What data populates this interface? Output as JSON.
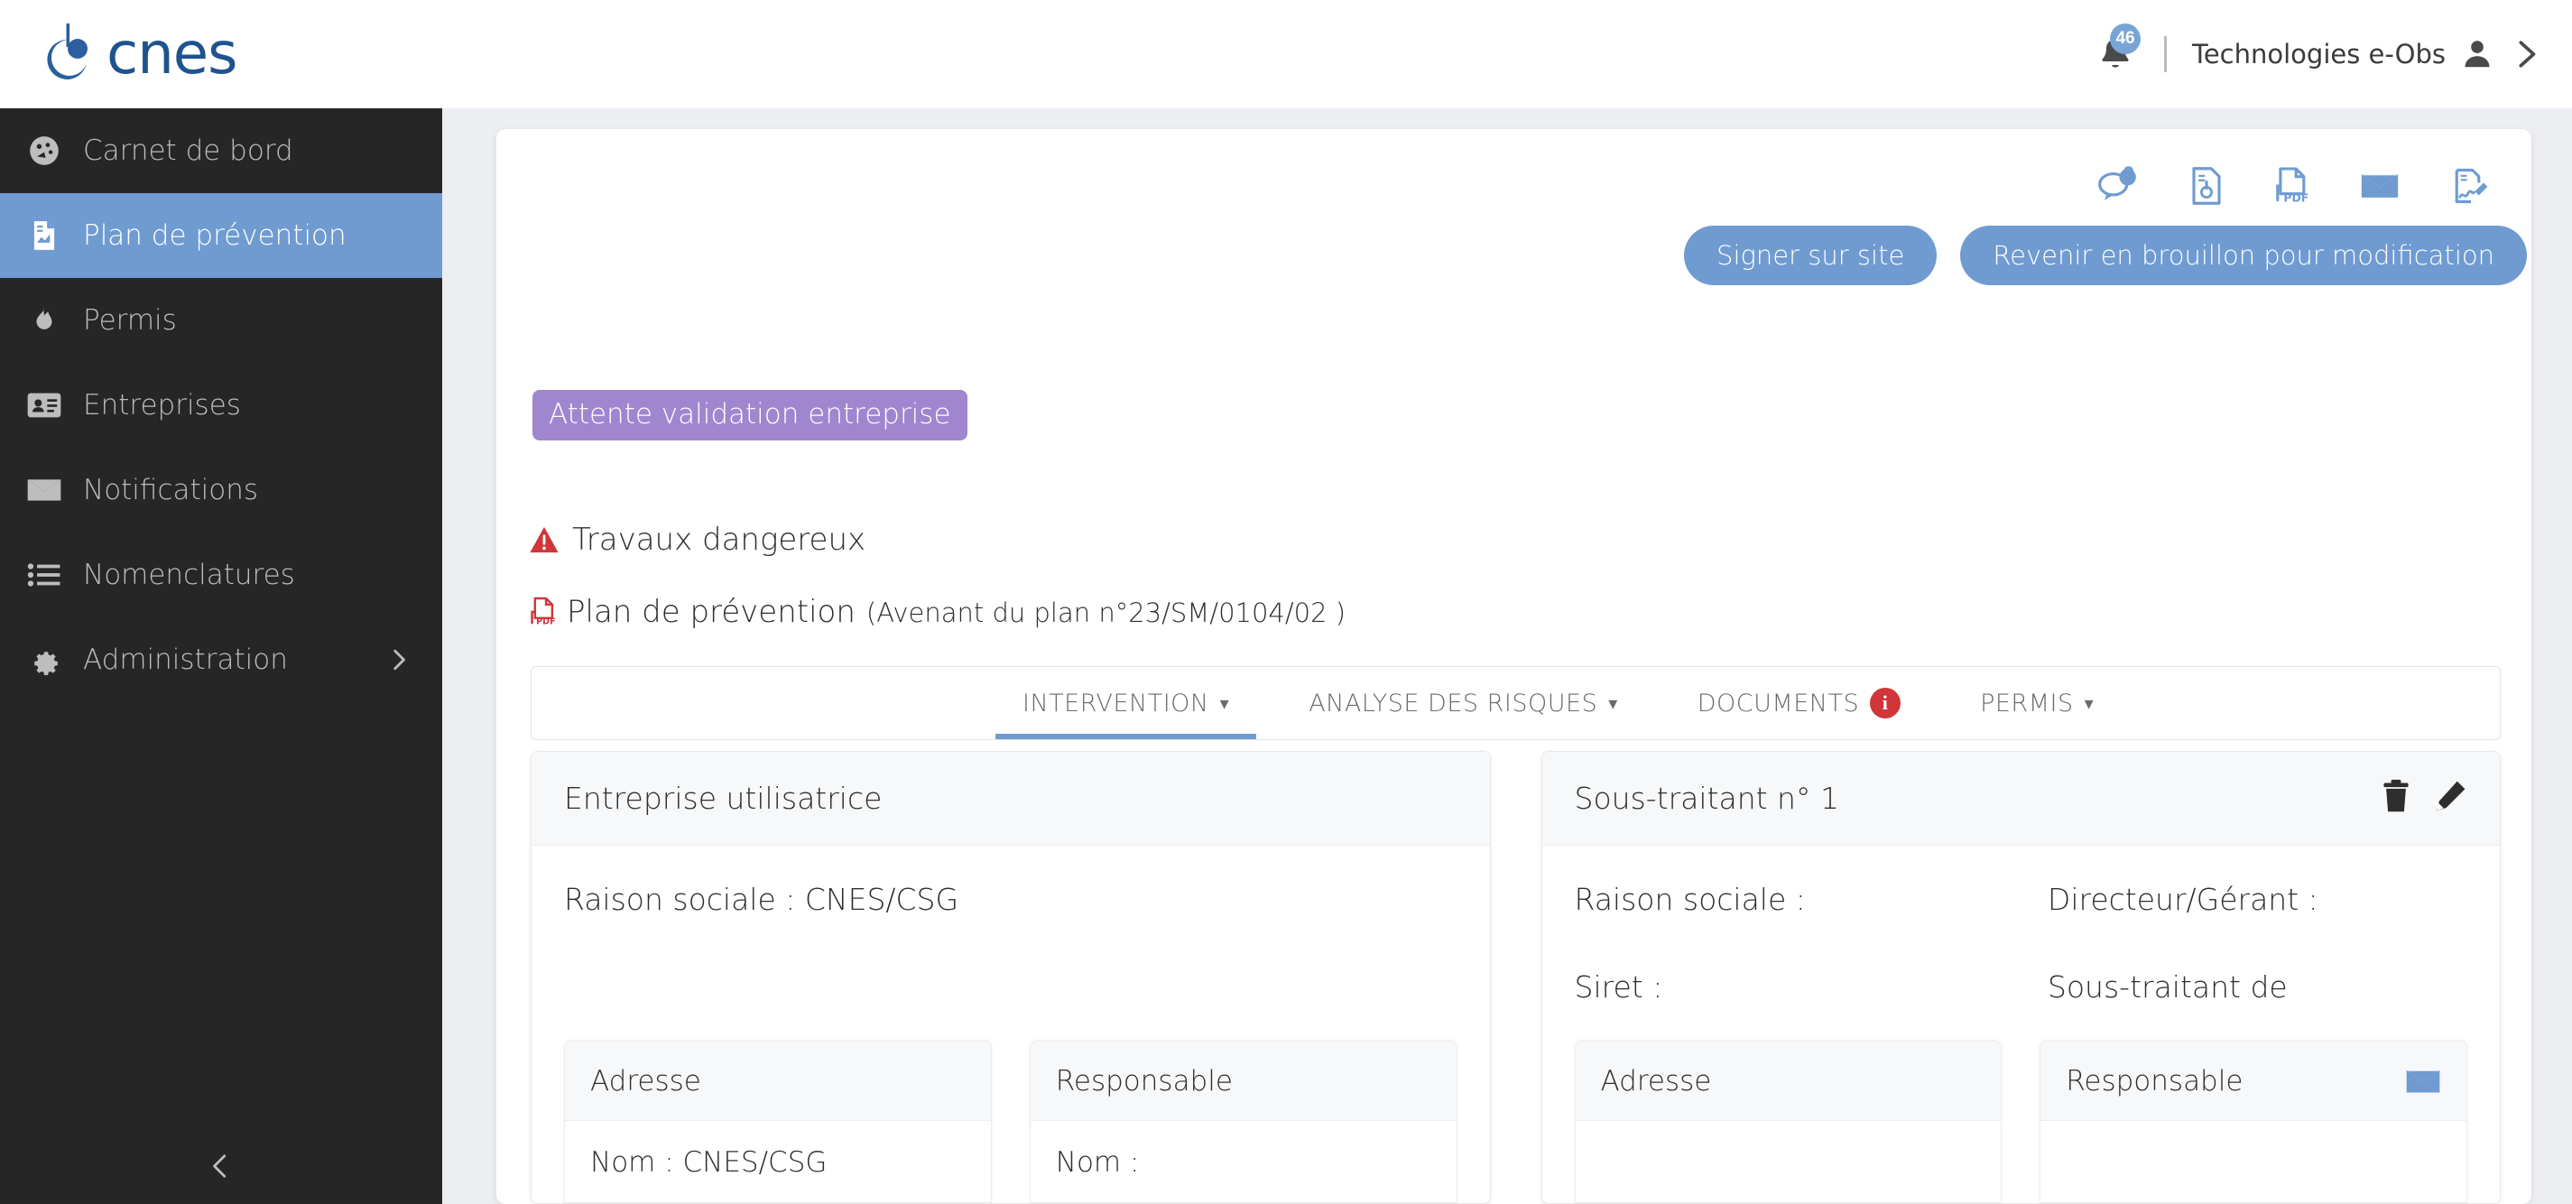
{
  "app": {
    "brand": "cnes",
    "background_color": "#eceef2",
    "accent_color": "#6f9bd1",
    "sidebar_color": "#262626",
    "status_color": "#a086cf",
    "danger_color": "#d0353a"
  },
  "header": {
    "notification_count": "46",
    "user_name": "Technologies e-Obs",
    "bell_icon": "bell-icon",
    "user_icon": "user-icon",
    "expand_icon": "chevron-right-icon"
  },
  "sidebar": {
    "collapse_icon": "chevron-left-icon",
    "items": [
      {
        "label": "Carnet de bord",
        "icon": "dashboard-icon",
        "active": false,
        "has_submenu": false
      },
      {
        "label": "Plan de prévention",
        "icon": "document-chart-icon",
        "active": true,
        "has_submenu": false
      },
      {
        "label": "Permis",
        "icon": "flame-icon",
        "active": false,
        "has_submenu": false
      },
      {
        "label": "Entreprises",
        "icon": "id-card-icon",
        "active": false,
        "has_submenu": false
      },
      {
        "label": "Notifications",
        "icon": "envelope-icon",
        "active": false,
        "has_submenu": false
      },
      {
        "label": "Nomenclatures",
        "icon": "list-icon",
        "active": false,
        "has_submenu": false
      },
      {
        "label": "Administration",
        "icon": "gear-icon",
        "active": false,
        "has_submenu": true
      }
    ]
  },
  "toolbar": {
    "icons": [
      {
        "name": "comments-icon",
        "badge": "0"
      },
      {
        "name": "document-report-icon",
        "badge": ""
      },
      {
        "name": "pdf-icon",
        "badge": ""
      },
      {
        "name": "mail-icon",
        "badge": ""
      },
      {
        "name": "sign-document-icon",
        "badge": ""
      }
    ],
    "buttons": [
      {
        "label": "Signer sur site",
        "name": "sign-on-site-button"
      },
      {
        "label": "Revenir en brouillon pour modification",
        "name": "return-to-draft-button"
      }
    ]
  },
  "status": {
    "label": "Attente validation entreprise"
  },
  "document": {
    "danger_label": "Travaux dangereux",
    "danger_icon": "warning-triangle-icon",
    "plan_title": "Plan de prévention",
    "plan_subtitle": "(Avenant du plan n°23/SM/0104/02 )",
    "plan_icon": "pdf-icon"
  },
  "tabs": [
    {
      "label": "INTERVENTION",
      "active": true,
      "caret": "▾",
      "badge": ""
    },
    {
      "label": "ANALYSE DES RISQUES",
      "active": false,
      "caret": "▾",
      "badge": ""
    },
    {
      "label": "DOCUMENTS",
      "active": false,
      "caret": "",
      "badge": "i"
    },
    {
      "label": "PERMIS",
      "active": false,
      "caret": "▾",
      "badge": ""
    }
  ],
  "panels": [
    {
      "title": "Entreprise utilisatrice",
      "name": "entreprise-utilisatrice-panel",
      "header_icons": [],
      "fields": [
        {
          "left": "Raison sociale : CNES/CSG",
          "right": ""
        }
      ],
      "sub_cards": [
        {
          "title": "Adresse",
          "name": "adresse-subcard",
          "icon": "",
          "line": "Nom : CNES/CSG",
          "tooltip": false
        },
        {
          "title": "Responsable",
          "name": "responsable-subcard",
          "icon": "",
          "line": "Nom :",
          "tooltip": true
        }
      ]
    },
    {
      "title": "Sous-traitant n° 1",
      "name": "sous-traitant-panel",
      "header_icons": [
        {
          "name": "trash-icon"
        },
        {
          "name": "pencil-icon"
        }
      ],
      "fields": [
        {
          "left": "Raison sociale :",
          "right": "Directeur/Gérant :"
        },
        {
          "left": "Siret :",
          "right": "Sous-traitant de"
        }
      ],
      "sub_cards": [
        {
          "title": "Adresse",
          "name": "adresse-subcard-st",
          "icon": "",
          "line": "",
          "tooltip": false
        },
        {
          "title": "Responsable",
          "name": "responsable-subcard-st",
          "icon": "mail-icon",
          "line": "",
          "tooltip": false
        }
      ]
    }
  ]
}
